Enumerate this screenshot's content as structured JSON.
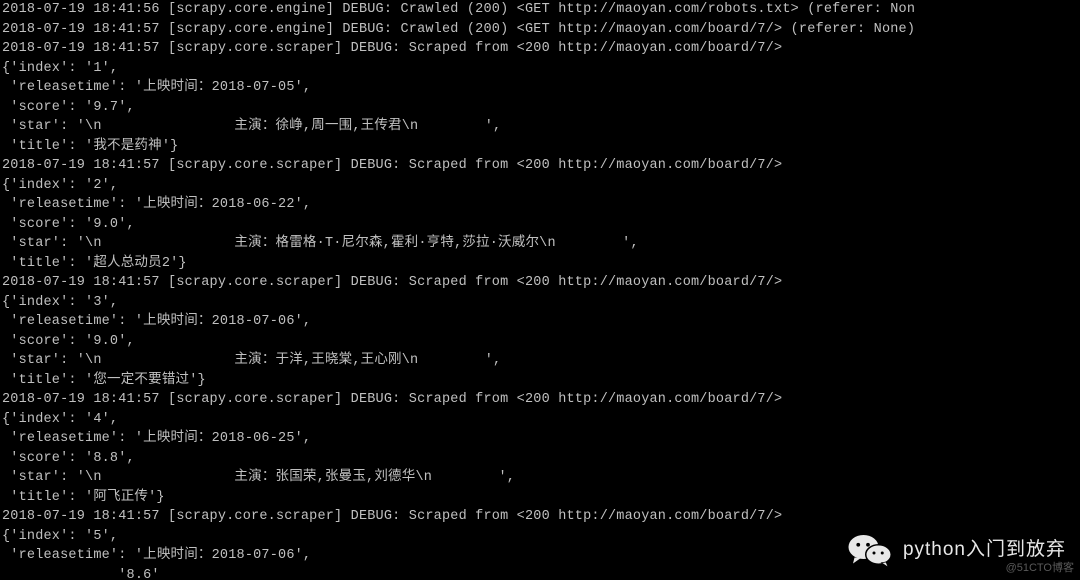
{
  "engine_lines": [
    "2018-07-19 18:41:56 [scrapy.core.engine] DEBUG: Crawled (200) <GET http://maoyan.com/robots.txt> (referer: Non",
    "2018-07-19 18:41:57 [scrapy.core.engine] DEBUG: Crawled (200) <GET http://maoyan.com/board/7/> (referer: None)"
  ],
  "scraped_header": "2018-07-19 18:41:57 [scrapy.core.scraper] DEBUG: Scraped from <200 http://maoyan.com/board/7/>",
  "items": [
    {
      "index": "1",
      "releasetime": "上映时间：2018-07-05",
      "score": "9.7",
      "star": "\\n                主演：徐峥,周一围,王传君\\n        ",
      "title": "我不是药神"
    },
    {
      "index": "2",
      "releasetime": "上映时间：2018-06-22",
      "score": "9.0",
      "star": "\\n                主演：格雷格·T·尼尔森,霍利·亨特,莎拉·沃威尔\\n        ",
      "title": "超人总动员2"
    },
    {
      "index": "3",
      "releasetime": "上映时间：2018-07-06",
      "score": "9.0",
      "star": "\\n                主演：于洋,王晓棠,王心刚\\n        ",
      "title": "您一定不要错过"
    },
    {
      "index": "4",
      "releasetime": "上映时间：2018-06-25",
      "score": "8.8",
      "star": "\\n                主演：张国荣,张曼玉,刘德华\\n        ",
      "title": "阿飞正传"
    },
    {
      "index": "5",
      "releasetime": "上映时间：2018-07-06",
      "score": "",
      "star": "",
      "title": ""
    }
  ],
  "trailing_partial": "              '8.6'",
  "overlay": {
    "label": "python入门到放弃"
  },
  "watermark": "@51CTO博客"
}
